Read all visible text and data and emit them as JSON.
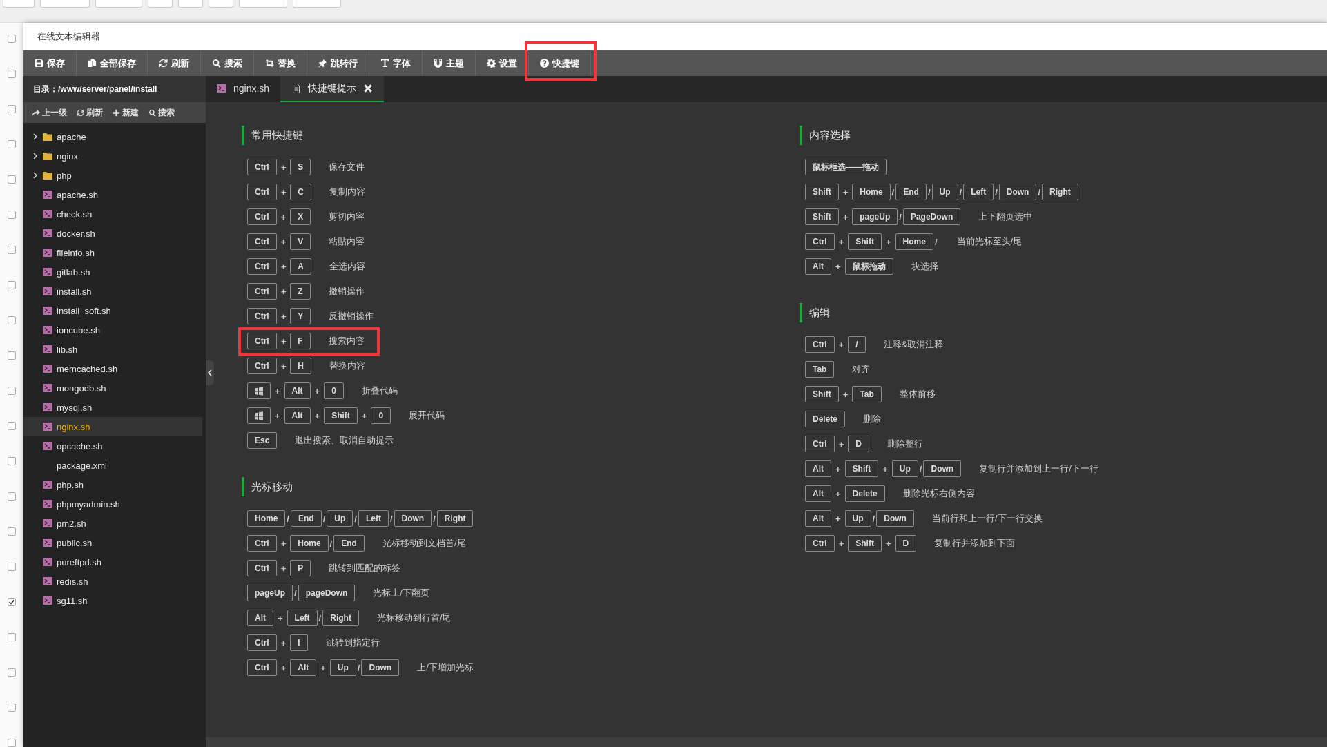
{
  "checkboxes": [
    {
      "checked": false
    },
    {
      "checked": false
    },
    {
      "checked": false
    },
    {
      "checked": false
    },
    {
      "checked": false
    },
    {
      "checked": false
    },
    {
      "checked": false
    },
    {
      "checked": false
    },
    {
      "checked": false
    },
    {
      "checked": false
    },
    {
      "checked": false
    },
    {
      "checked": false
    },
    {
      "checked": false
    },
    {
      "checked": false
    },
    {
      "checked": false
    },
    {
      "checked": false
    },
    {
      "checked": true
    },
    {
      "checked": false
    },
    {
      "checked": false
    },
    {
      "checked": false
    },
    {
      "checked": false
    }
  ],
  "window": {
    "title": "在线文本编辑器"
  },
  "toolbar": [
    {
      "label": "保存",
      "highlighted": false
    },
    {
      "label": "全部保存",
      "highlighted": false
    },
    {
      "label": "刷新",
      "highlighted": false
    },
    {
      "label": "搜索",
      "highlighted": false
    },
    {
      "label": "替换",
      "highlighted": false
    },
    {
      "label": "跳转行",
      "highlighted": false
    },
    {
      "label": "字体",
      "highlighted": false
    },
    {
      "label": "主题",
      "highlighted": false
    },
    {
      "label": "设置",
      "highlighted": false
    },
    {
      "label": "快捷键",
      "highlighted": true
    }
  ],
  "sidebar": {
    "path": "目录：/www/server/panel/install",
    "actions": [
      {
        "label": "上一级"
      },
      {
        "label": "刷新"
      },
      {
        "label": "新建"
      },
      {
        "label": "搜索"
      }
    ],
    "items": [
      {
        "kind": "folder",
        "name": "apache",
        "selected": false
      },
      {
        "kind": "folder",
        "name": "nginx",
        "selected": false
      },
      {
        "kind": "folder",
        "name": "php",
        "selected": false
      },
      {
        "kind": "script",
        "name": "apache.sh",
        "selected": false
      },
      {
        "kind": "script",
        "name": "check.sh",
        "selected": false
      },
      {
        "kind": "script",
        "name": "docker.sh",
        "selected": false
      },
      {
        "kind": "script",
        "name": "fileinfo.sh",
        "selected": false
      },
      {
        "kind": "script",
        "name": "gitlab.sh",
        "selected": false
      },
      {
        "kind": "script",
        "name": "install.sh",
        "selected": false
      },
      {
        "kind": "script",
        "name": "install_soft.sh",
        "selected": false
      },
      {
        "kind": "script",
        "name": "ioncube.sh",
        "selected": false
      },
      {
        "kind": "script",
        "name": "lib.sh",
        "selected": false
      },
      {
        "kind": "script",
        "name": "memcached.sh",
        "selected": false
      },
      {
        "kind": "script",
        "name": "mongodb.sh",
        "selected": false
      },
      {
        "kind": "script",
        "name": "mysql.sh",
        "selected": false
      },
      {
        "kind": "script",
        "name": "nginx.sh",
        "selected": true
      },
      {
        "kind": "script",
        "name": "opcache.sh",
        "selected": false
      },
      {
        "kind": "file",
        "name": "package.xml",
        "selected": false
      },
      {
        "kind": "script",
        "name": "php.sh",
        "selected": false
      },
      {
        "kind": "script",
        "name": "phpmyadmin.sh",
        "selected": false
      },
      {
        "kind": "script",
        "name": "pm2.sh",
        "selected": false
      },
      {
        "kind": "script",
        "name": "public.sh",
        "selected": false
      },
      {
        "kind": "script",
        "name": "pureftpd.sh",
        "selected": false
      },
      {
        "kind": "script",
        "name": "redis.sh",
        "selected": false
      },
      {
        "kind": "script",
        "name": "sg11.sh",
        "selected": false
      }
    ]
  },
  "tabs": [
    {
      "kind": "script",
      "label": "nginx.sh",
      "selected": false,
      "closable": false
    },
    {
      "kind": "document",
      "label": "快捷键提示",
      "selected": true,
      "closable": true
    }
  ],
  "columns": [
    {
      "sections": [
        {
          "title": "常用快捷键",
          "rows": [
            {
              "keys": [
                {
                  "kind": "key",
                  "text": "Ctrl"
                },
                {
                  "kind": "sep",
                  "text": "+"
                },
                {
                  "kind": "key",
                  "text": "S"
                }
              ],
              "description": "保存文件",
              "highlighted": false
            },
            {
              "keys": [
                {
                  "kind": "key",
                  "text": "Ctrl"
                },
                {
                  "kind": "sep",
                  "text": "+"
                },
                {
                  "kind": "key",
                  "text": "C"
                }
              ],
              "description": "复制内容",
              "highlighted": false
            },
            {
              "keys": [
                {
                  "kind": "key",
                  "text": "Ctrl"
                },
                {
                  "kind": "sep",
                  "text": "+"
                },
                {
                  "kind": "key",
                  "text": "X"
                }
              ],
              "description": "剪切内容",
              "highlighted": false
            },
            {
              "keys": [
                {
                  "kind": "key",
                  "text": "Ctrl"
                },
                {
                  "kind": "sep",
                  "text": "+"
                },
                {
                  "kind": "key",
                  "text": "V"
                }
              ],
              "description": "粘贴内容",
              "highlighted": false
            },
            {
              "keys": [
                {
                  "kind": "key",
                  "text": "Ctrl"
                },
                {
                  "kind": "sep",
                  "text": "+"
                },
                {
                  "kind": "key",
                  "text": "A"
                }
              ],
              "description": "全选内容",
              "highlighted": false
            },
            {
              "keys": [
                {
                  "kind": "key",
                  "text": "Ctrl"
                },
                {
                  "kind": "sep",
                  "text": "+"
                },
                {
                  "kind": "key",
                  "text": "Z"
                }
              ],
              "description": "撤销操作",
              "highlighted": false
            },
            {
              "keys": [
                {
                  "kind": "key",
                  "text": "Ctrl"
                },
                {
                  "kind": "sep",
                  "text": "+"
                },
                {
                  "kind": "key",
                  "text": "Y"
                }
              ],
              "description": "反撤销操作",
              "highlighted": false
            },
            {
              "keys": [
                {
                  "kind": "key",
                  "text": "Ctrl"
                },
                {
                  "kind": "sep",
                  "text": "+"
                },
                {
                  "kind": "key",
                  "text": "F"
                }
              ],
              "description": "搜索内容",
              "highlighted": true
            },
            {
              "keys": [
                {
                  "kind": "key",
                  "text": "Ctrl"
                },
                {
                  "kind": "sep",
                  "text": "+"
                },
                {
                  "kind": "key",
                  "text": "H"
                }
              ],
              "description": "替换内容",
              "highlighted": false
            },
            {
              "keys": [
                {
                  "kind": "logo"
                },
                {
                  "kind": "sep",
                  "text": "+"
                },
                {
                  "kind": "key",
                  "text": "Alt"
                },
                {
                  "kind": "sep",
                  "text": "+"
                },
                {
                  "kind": "key",
                  "text": "0"
                }
              ],
              "description": "折叠代码",
              "highlighted": false
            },
            {
              "keys": [
                {
                  "kind": "logo"
                },
                {
                  "kind": "sep",
                  "text": "+"
                },
                {
                  "kind": "key",
                  "text": "Alt"
                },
                {
                  "kind": "sep",
                  "text": "+"
                },
                {
                  "kind": "key",
                  "text": "Shift"
                },
                {
                  "kind": "sep",
                  "text": "+"
                },
                {
                  "kind": "key",
                  "text": "0"
                }
              ],
              "description": "展开代码",
              "highlighted": false
            },
            {
              "keys": [
                {
                  "kind": "key",
                  "text": "Esc"
                }
              ],
              "description": "退出搜索、取消自动提示",
              "highlighted": false
            }
          ]
        },
        {
          "title": "光标移动",
          "rows": [
            {
              "keys": [
                {
                  "kind": "key",
                  "text": "Home"
                },
                {
                  "kind": "sep",
                  "text": "/"
                },
                {
                  "kind": "key",
                  "text": "End"
                },
                {
                  "kind": "sep",
                  "text": "/"
                },
                {
                  "kind": "key",
                  "text": "Up"
                },
                {
                  "kind": "sep",
                  "text": "/"
                },
                {
                  "kind": "key",
                  "text": "Left"
                },
                {
                  "kind": "sep",
                  "text": "/"
                },
                {
                  "kind": "key",
                  "text": "Down"
                },
                {
                  "kind": "sep",
                  "text": "/"
                },
                {
                  "kind": "key",
                  "text": "Right"
                }
              ],
              "highlighted": false
            },
            {
              "keys": [
                {
                  "kind": "key",
                  "text": "Ctrl"
                },
                {
                  "kind": "sep",
                  "text": "+"
                },
                {
                  "kind": "key",
                  "text": "Home"
                },
                {
                  "kind": "sep",
                  "text": "/"
                },
                {
                  "kind": "key",
                  "text": "End"
                }
              ],
              "description": "光标移动到文档首/尾",
              "highlighted": false
            },
            {
              "keys": [
                {
                  "kind": "key",
                  "text": "Ctrl"
                },
                {
                  "kind": "sep",
                  "text": "+"
                },
                {
                  "kind": "key",
                  "text": "P"
                }
              ],
              "description": "跳转到匹配的标签",
              "highlighted": false
            },
            {
              "keys": [
                {
                  "kind": "key",
                  "text": "pageUp"
                },
                {
                  "kind": "sep",
                  "text": "/"
                },
                {
                  "kind": "key",
                  "text": "pageDown"
                }
              ],
              "description": "光标上/下翻页",
              "highlighted": false
            },
            {
              "keys": [
                {
                  "kind": "key",
                  "text": "Alt"
                },
                {
                  "kind": "sep",
                  "text": "+"
                },
                {
                  "kind": "key",
                  "text": "Left"
                },
                {
                  "kind": "sep",
                  "text": "/"
                },
                {
                  "kind": "key",
                  "text": "Right"
                }
              ],
              "description": "光标移动到行首/尾",
              "highlighted": false
            },
            {
              "keys": [
                {
                  "kind": "key",
                  "text": "Ctrl"
                },
                {
                  "kind": "sep",
                  "text": "+"
                },
                {
                  "kind": "key",
                  "text": "I"
                }
              ],
              "description": "跳转到指定行",
              "highlighted": false
            },
            {
              "keys": [
                {
                  "kind": "key",
                  "text": "Ctrl"
                },
                {
                  "kind": "sep",
                  "text": "+"
                },
                {
                  "kind": "key",
                  "text": "Alt"
                },
                {
                  "kind": "sep",
                  "text": "+"
                },
                {
                  "kind": "key",
                  "text": "Up"
                },
                {
                  "kind": "sep",
                  "text": "/"
                },
                {
                  "kind": "key",
                  "text": "Down"
                }
              ],
              "description": "上/下增加光标",
              "highlighted": false
            }
          ]
        }
      ]
    },
    {
      "sections": [
        {
          "title": "内容选择",
          "rows": [
            {
              "keys": [
                {
                  "kind": "key",
                  "text": "鼠标框选——拖动"
                }
              ],
              "highlighted": false
            },
            {
              "keys": [
                {
                  "kind": "key",
                  "text": "Shift"
                },
                {
                  "kind": "sep",
                  "text": "+"
                },
                {
                  "kind": "key",
                  "text": "Home"
                },
                {
                  "kind": "sep",
                  "text": "/"
                },
                {
                  "kind": "key",
                  "text": "End"
                },
                {
                  "kind": "sep",
                  "text": "/"
                },
                {
                  "kind": "key",
                  "text": "Up"
                },
                {
                  "kind": "sep",
                  "text": "/"
                },
                {
                  "kind": "key",
                  "text": "Left"
                },
                {
                  "kind": "sep",
                  "text": "/"
                },
                {
                  "kind": "key",
                  "text": "Down"
                },
                {
                  "kind": "sep",
                  "text": "/"
                },
                {
                  "kind": "key",
                  "text": "Right"
                }
              ],
              "highlighted": false
            },
            {
              "keys": [
                {
                  "kind": "key",
                  "text": "Shift"
                },
                {
                  "kind": "sep",
                  "text": "+"
                },
                {
                  "kind": "key",
                  "text": "pageUp"
                },
                {
                  "kind": "sep",
                  "text": "/"
                },
                {
                  "kind": "key",
                  "text": "PageDown"
                }
              ],
              "description": "上下翻页选中",
              "highlighted": false
            },
            {
              "keys": [
                {
                  "kind": "key",
                  "text": "Ctrl"
                },
                {
                  "kind": "sep",
                  "text": "+"
                },
                {
                  "kind": "key",
                  "text": "Shift"
                },
                {
                  "kind": "sep",
                  "text": "+"
                },
                {
                  "kind": "key",
                  "text": "Home"
                },
                {
                  "kind": "sep",
                  "text": "/"
                }
              ],
              "description": "当前光标至头/尾",
              "highlighted": false
            },
            {
              "keys": [
                {
                  "kind": "key",
                  "text": "Alt"
                },
                {
                  "kind": "sep",
                  "text": "+"
                },
                {
                  "kind": "key",
                  "text": "鼠标拖动"
                }
              ],
              "description": "块选择",
              "highlighted": false
            }
          ]
        },
        {
          "title": "编辑",
          "rows": [
            {
              "keys": [
                {
                  "kind": "key",
                  "text": "Ctrl"
                },
                {
                  "kind": "sep",
                  "text": "+"
                },
                {
                  "kind": "key",
                  "text": "/"
                }
              ],
              "description": "注释&取消注释",
              "highlighted": false
            },
            {
              "keys": [
                {
                  "kind": "key",
                  "text": "Tab"
                }
              ],
              "description": "对齐",
              "highlighted": false
            },
            {
              "keys": [
                {
                  "kind": "key",
                  "text": "Shift"
                },
                {
                  "kind": "sep",
                  "text": "+"
                },
                {
                  "kind": "key",
                  "text": "Tab"
                }
              ],
              "description": "整体前移",
              "highlighted": false
            },
            {
              "keys": [
                {
                  "kind": "key",
                  "text": "Delete"
                }
              ],
              "description": "删除",
              "highlighted": false
            },
            {
              "keys": [
                {
                  "kind": "key",
                  "text": "Ctrl"
                },
                {
                  "kind": "sep",
                  "text": "+"
                },
                {
                  "kind": "key",
                  "text": "D"
                }
              ],
              "description": "删除整行",
              "highlighted": false
            },
            {
              "keys": [
                {
                  "kind": "key",
                  "text": "Alt"
                },
                {
                  "kind": "sep",
                  "text": "+"
                },
                {
                  "kind": "key",
                  "text": "Shift"
                },
                {
                  "kind": "sep",
                  "text": "+"
                },
                {
                  "kind": "key",
                  "text": "Up"
                },
                {
                  "kind": "sep",
                  "text": "/"
                },
                {
                  "kind": "key",
                  "text": "Down"
                }
              ],
              "description": "复制行并添加到上一行/下一行",
              "highlighted": false
            },
            {
              "keys": [
                {
                  "kind": "key",
                  "text": "Alt"
                },
                {
                  "kind": "sep",
                  "text": "+"
                },
                {
                  "kind": "key",
                  "text": "Delete"
                }
              ],
              "description": "删除光标右侧内容",
              "highlighted": false
            },
            {
              "keys": [
                {
                  "kind": "key",
                  "text": "Alt"
                },
                {
                  "kind": "sep",
                  "text": "+"
                },
                {
                  "kind": "key",
                  "text": "Up"
                },
                {
                  "kind": "sep",
                  "text": "/"
                },
                {
                  "kind": "key",
                  "text": "Down"
                }
              ],
              "description": "当前行和上一行/下一行交换",
              "highlighted": false
            },
            {
              "keys": [
                {
                  "kind": "key",
                  "text": "Ctrl"
                },
                {
                  "kind": "sep",
                  "text": "+"
                },
                {
                  "kind": "key",
                  "text": "Shift"
                },
                {
                  "kind": "sep",
                  "text": "+"
                },
                {
                  "kind": "key",
                  "text": "D"
                }
              ],
              "description": "复制行并添加到下面",
              "highlighted": false
            }
          ]
        }
      ]
    }
  ]
}
